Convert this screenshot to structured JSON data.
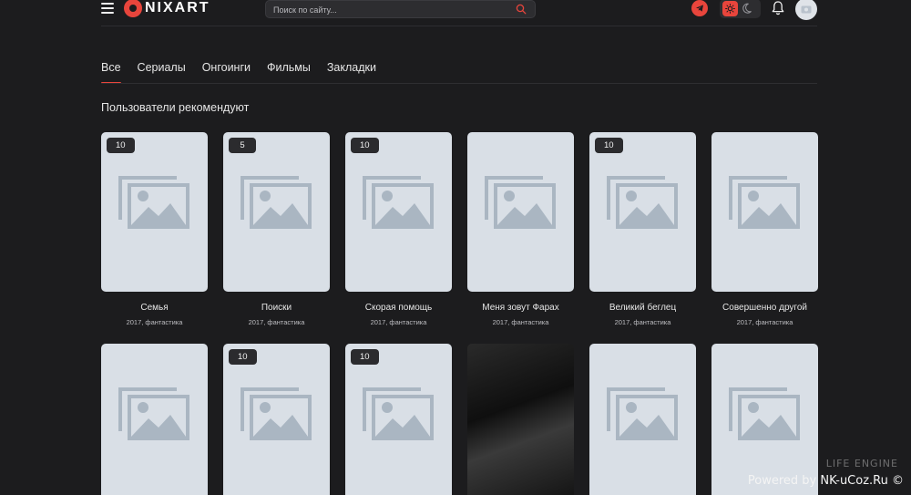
{
  "header": {
    "logo_text": "NIXART",
    "search_placeholder": "Поиск по сайту...",
    "icons": [
      "menu-icon",
      "search-icon",
      "telegram-icon",
      "sun-icon",
      "moon-icon",
      "bell-icon",
      "avatar-icon"
    ],
    "accent_color": "#e8453c"
  },
  "tabs": [
    {
      "label": "Все",
      "active": true
    },
    {
      "label": "Сериалы",
      "active": false
    },
    {
      "label": "Онгоинги",
      "active": false
    },
    {
      "label": "Фильмы",
      "active": false
    },
    {
      "label": "Закладки",
      "active": false
    }
  ],
  "section": {
    "title": "Пользователи рекомендуют"
  },
  "cards": [
    {
      "rating": "10",
      "title": "Семья",
      "meta": "2017, фантастика",
      "image": "placeholder"
    },
    {
      "rating": "5",
      "title": "Поиски",
      "meta": "2017, фантастика",
      "image": "placeholder"
    },
    {
      "rating": "10",
      "title": "Скорая помощь",
      "meta": "2017, фантастика",
      "image": "placeholder"
    },
    {
      "rating": "",
      "title": "Меня зовут Фарах",
      "meta": "2017, фантастика",
      "image": "placeholder"
    },
    {
      "rating": "10",
      "title": "Великий беглец",
      "meta": "2017, фантастика",
      "image": "placeholder"
    },
    {
      "rating": "",
      "title": "Совершенно другой",
      "meta": "2017, фантастика",
      "image": "placeholder"
    },
    {
      "rating": "",
      "title": "",
      "meta": "",
      "image": "placeholder"
    },
    {
      "rating": "10",
      "title": "",
      "meta": "",
      "image": "placeholder"
    },
    {
      "rating": "10",
      "title": "",
      "meta": "",
      "image": "placeholder"
    },
    {
      "rating": "",
      "title": "",
      "meta": "",
      "image": "photo"
    },
    {
      "rating": "",
      "title": "",
      "meta": "",
      "image": "placeholder"
    },
    {
      "rating": "",
      "title": "",
      "meta": "",
      "image": "placeholder"
    }
  ],
  "footer": {
    "watermark": "LIFE ENGINE",
    "powered": "Powered by NK-uCoz.Ru ©"
  }
}
